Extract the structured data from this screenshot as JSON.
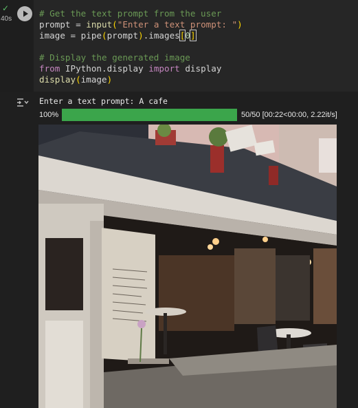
{
  "cell": {
    "status_icon": "check-icon",
    "exec_time": "40s",
    "run_button_icon": "play-icon"
  },
  "code": {
    "l1_comment": "# Get the text prompt from the user",
    "l2_var": "prompt = ",
    "l2_fn": "input",
    "l2_open": "(",
    "l2_str": "\"Enter a text prompt: \"",
    "l2_close": ")",
    "l3_a": "image = pipe",
    "l3_open": "(",
    "l3_b": "prompt",
    "l3_close": ")",
    "l3_c": ".images",
    "l3_ob": "[",
    "l3_num": "0",
    "l3_cb": "]",
    "l5_comment": "# Display the generated image",
    "l6_from": "from",
    "l6_mod": " IPython.display ",
    "l6_import": "import",
    "l6_name": " display",
    "l7_fn": "display",
    "l7_open": "(",
    "l7_arg": "image",
    "l7_close": ")"
  },
  "output": {
    "icon": "output-toggle-icon",
    "prompt_echo": "Enter a text prompt: A cafe",
    "progress": {
      "percent_label": "100%",
      "fraction": 1.0,
      "stats": "50/50 [00:22<00:00,  2.22it/s]"
    },
    "image_subject": "generated-cafe-image"
  },
  "colors": {
    "progress_fill": "#3ba54b",
    "status_check": "#5ec26a"
  }
}
